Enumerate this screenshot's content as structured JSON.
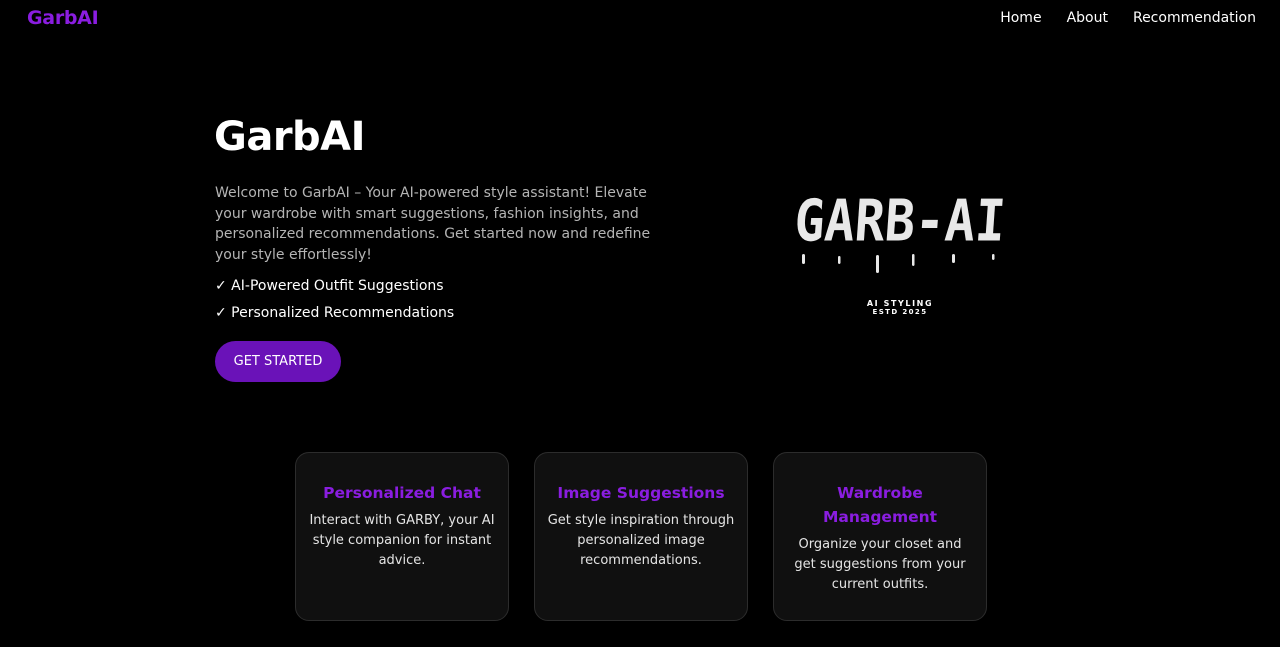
{
  "nav": {
    "brand": "GarbAI",
    "links": [
      "Home",
      "About",
      "Recommendation"
    ]
  },
  "hero": {
    "title": "GarbAI",
    "description": "Welcome to GarbAI – Your AI-powered style assistant! Elevate your wardrobe with smart suggestions, fashion insights, and personalized recommendations. Get started now and redefine your style effortlessly!",
    "features": [
      "✓ AI-Powered Outfit Suggestions",
      "✓ Personalized Recommendations"
    ],
    "cta_label": "GET STARTED"
  },
  "logo": {
    "word": "GARB-AI",
    "line1": "AI STYLING",
    "line2": "ESTD 2025"
  },
  "cards": [
    {
      "title": "Personalized Chat",
      "text": "Interact with GARBY, your AI style companion for instant advice."
    },
    {
      "title": "Image Suggestions",
      "text": "Get style inspiration through personalized image recommendations."
    },
    {
      "title": "Wardrobe Management",
      "text": "Organize your closet and get suggestions from your current outfits."
    }
  ],
  "colors": {
    "accent": "#8a1de0",
    "button": "#6a12b8",
    "background": "#000000",
    "card_background": "#101010"
  }
}
